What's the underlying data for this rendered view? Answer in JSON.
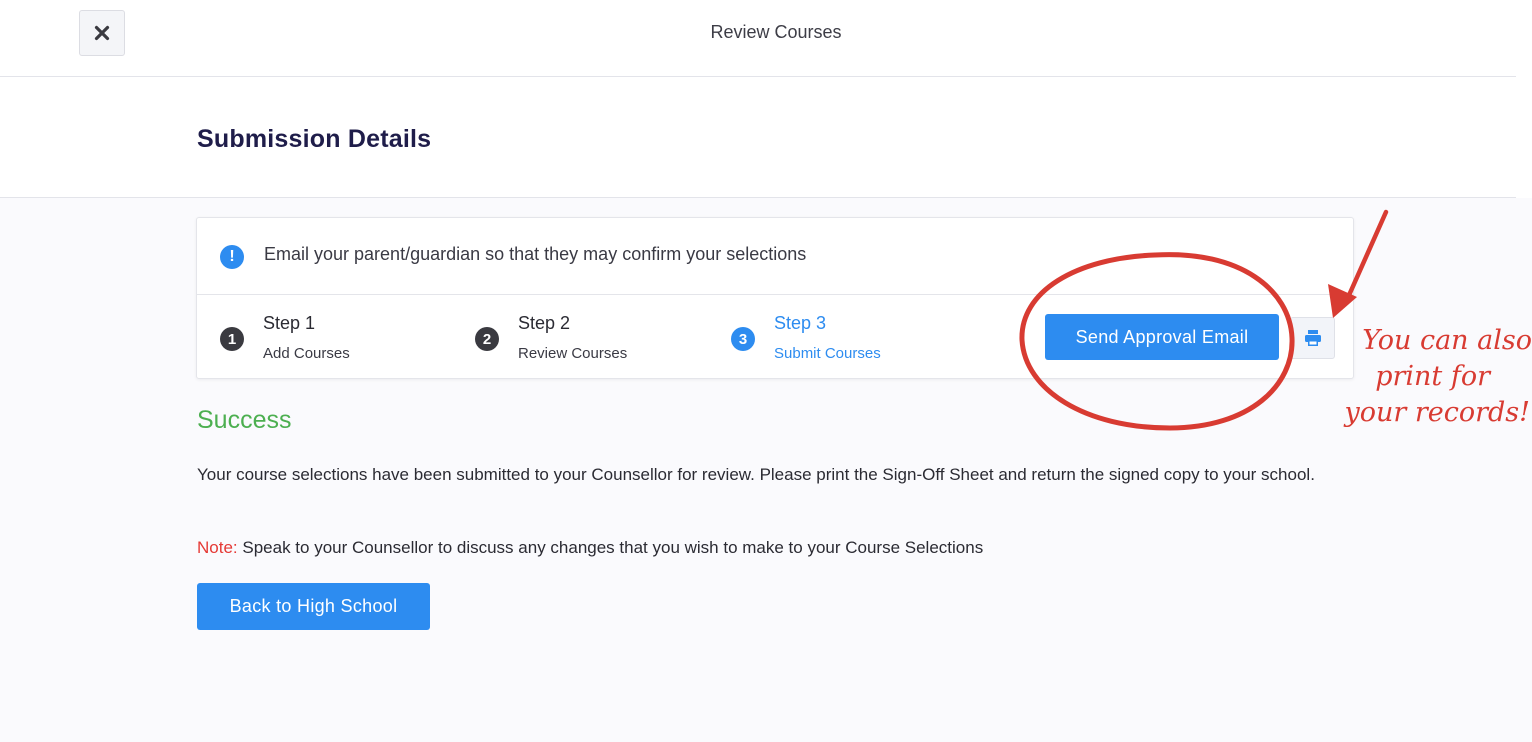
{
  "topbar": {
    "close_icon": "close-icon",
    "title": "Review Courses"
  },
  "header": {
    "title": "Submission Details"
  },
  "card": {
    "info_icon": "info-icon",
    "info_text": "Email your parent/guardian so that they may confirm your selections",
    "steps": [
      {
        "num": "1",
        "title": "Step 1",
        "subtitle": "Add Courses",
        "active": false
      },
      {
        "num": "2",
        "title": "Step 2",
        "subtitle": "Review Courses",
        "active": false
      },
      {
        "num": "3",
        "title": "Step 3",
        "subtitle": "Submit Courses",
        "active": true
      }
    ],
    "send_label": "Send Approval Email",
    "print_icon": "printer-icon"
  },
  "main": {
    "success_title": "Success",
    "body": "Your course selections have been submitted to your Counsellor for review. Please print the Sign-Off Sheet and return the signed copy to your school.",
    "note_label": "Note:",
    "note_text": " Speak to your Counsellor to discuss any changes that you wish to make to your Course Selections",
    "back_label": "Back to High School"
  },
  "annotation": {
    "line1": "You can also",
    "line2": "print for",
    "line3": "your records!"
  },
  "colors": {
    "primary": "#2d8cf0",
    "success": "#4caf50",
    "note": "#e53935",
    "annotation": "#d83b32",
    "title": "#1f1d4a"
  }
}
